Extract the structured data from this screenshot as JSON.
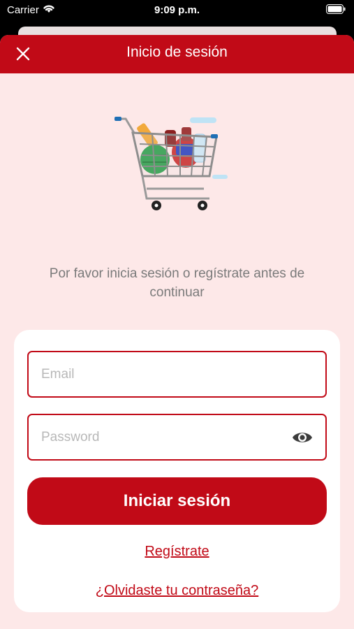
{
  "status_bar": {
    "carrier": "Carrier",
    "time": "9:09 p.m."
  },
  "header": {
    "title": "Inicio de sesión",
    "close_icon": "close-icon"
  },
  "illustration": "shopping-cart-icon",
  "message": "Por favor inicia sesión o regístrate antes de continuar",
  "form": {
    "email_placeholder": "Email",
    "email_value": "",
    "password_placeholder": "Password",
    "password_value": "",
    "password_toggle_icon": "eye-icon",
    "login_button": "Iniciar sesión",
    "register_link": "Regístrate",
    "forgot_link": "¿Olvidaste tu contraseña?"
  },
  "colors": {
    "brand": "#c10a17",
    "background": "#fde8e8",
    "card": "#ffffff",
    "message_text": "#7a7a7a"
  }
}
